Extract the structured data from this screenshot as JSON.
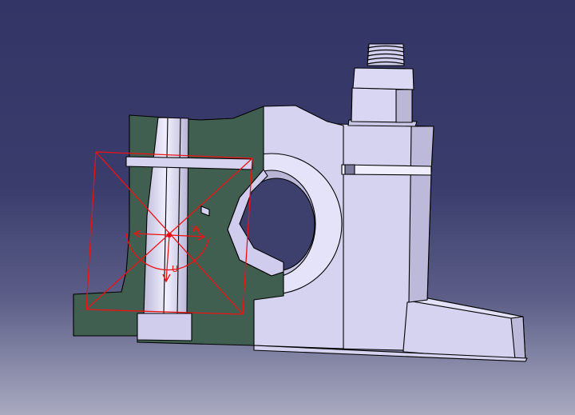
{
  "viewer": {
    "background_top": "#333566",
    "background_bottom": "#a9aac0"
  },
  "part": {
    "body_color": "#d6d3f1",
    "section_color": "#405f50",
    "edge_color": "#000000"
  },
  "compass": {
    "color": "#ee1111",
    "label_u": "U",
    "label_w": "W"
  }
}
